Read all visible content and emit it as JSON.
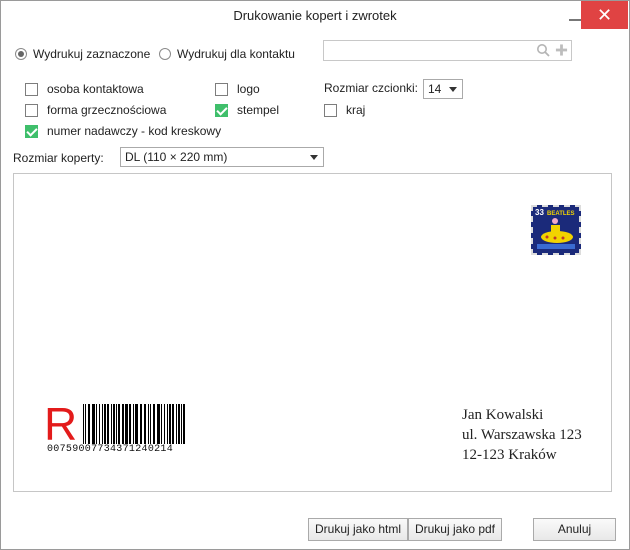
{
  "dialog": {
    "title": "Drukowanie kopert i zwrotek",
    "close_glyph": "✕"
  },
  "mode": {
    "options": [
      {
        "label": "Wydrukuj zaznaczone",
        "checked": true
      },
      {
        "label": "Wydrukuj dla kontaktu",
        "checked": false
      }
    ],
    "search_value": "",
    "search_icon": "search-icon",
    "add_icon": "plus-icon"
  },
  "options": {
    "col1": [
      {
        "label": "osoba kontaktowa",
        "checked": false
      },
      {
        "label": "forma grzecznościowa",
        "checked": false
      },
      {
        "label": "numer nadawczy - kod kreskowy",
        "checked": true
      }
    ],
    "col2": [
      {
        "label": "logo",
        "checked": false
      },
      {
        "label": "stempel",
        "checked": true
      }
    ],
    "col3": [
      {
        "label": "kraj",
        "checked": false
      }
    ],
    "font_size_label": "Rozmiar czcionki:",
    "font_size_value": "14"
  },
  "envelope_size": {
    "label": "Rozmiar koperty:",
    "value": "DL (110 × 220 mm)"
  },
  "preview": {
    "registered_mark": "R",
    "barcode_number": "00759007734371240214",
    "stamp": {
      "value": "33",
      "band": "BEATLES",
      "color": "#1b2a7a"
    },
    "address": [
      "Jan Kowalski",
      "ul. Warszawska 123",
      "12-123 Kraków"
    ]
  },
  "buttons": {
    "print_html": "Drukuj jako html",
    "print_pdf": "Drukuj jako pdf",
    "cancel": "Anuluj"
  },
  "colors": {
    "close": "#e04343",
    "check": "#3fbf6b",
    "r_mark": "#e31b1b"
  }
}
